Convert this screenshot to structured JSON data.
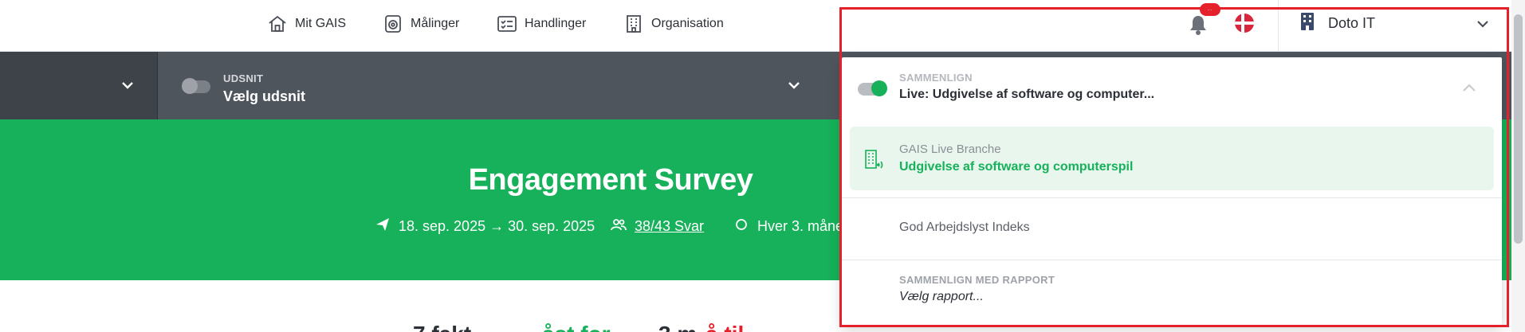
{
  "nav": {
    "items": [
      {
        "label": "Mit GAIS",
        "icon": "home-icon"
      },
      {
        "label": "Målinger",
        "icon": "survey-icon"
      },
      {
        "label": "Handlinger",
        "icon": "checklist-icon"
      },
      {
        "label": "Organisation",
        "icon": "building-icon"
      }
    ],
    "org_name": "Doto IT",
    "bell_badge": "··"
  },
  "filterbar": {
    "udsnit_label": "UDSNIT",
    "udsnit_value": "Vælg udsnit"
  },
  "hero": {
    "title": "Engagement Survey",
    "dates": "18. sep. 2025 → 30. sep. 2025",
    "responses": "38/43 Svar",
    "frequency": "Hver 3. måne"
  },
  "below": {
    "left": "7 fakt",
    "mid": "åst for",
    "right": "3 m",
    "red": "å til"
  },
  "dropdown": {
    "header_label": "SAMMENLIGN",
    "header_value": "Live: Udgivelse af software og computer...",
    "selected_sub": "GAIS Live Branche",
    "selected_main": "Udgivelse af software og computerspil",
    "option_plain": "God Arbejdslyst Indeks",
    "report_label": "SAMMENLIGN MED RAPPORT",
    "report_value": "Vælg rapport..."
  },
  "colors": {
    "green": "#16b15a",
    "dark_bar": "#4f555d",
    "highlight_border": "#e5202a"
  }
}
